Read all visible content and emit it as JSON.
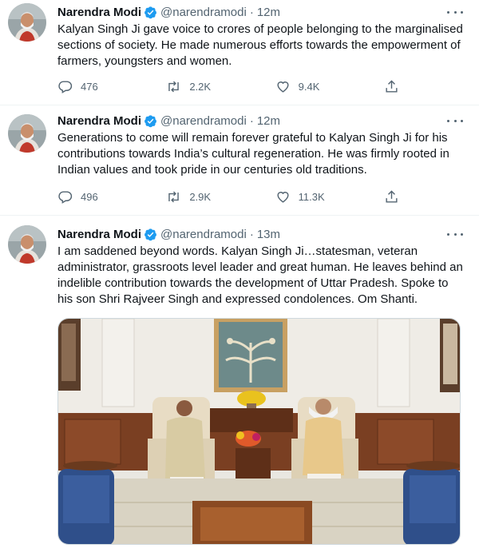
{
  "tweets": [
    {
      "name": "Narendra Modi",
      "handle": "@narendramodi",
      "dot": "·",
      "time": "12m",
      "text": "Kalyan Singh Ji gave voice to crores of people belonging to the marginalised sections of society. He made numerous efforts towards the empowerment of farmers, youngsters and women.",
      "replies": "476",
      "retweets": "2.2K",
      "likes": "9.4K"
    },
    {
      "name": "Narendra Modi",
      "handle": "@narendramodi",
      "dot": "·",
      "time": "12m",
      "text": "Generations to come will remain forever grateful to Kalyan Singh Ji for his contributions towards India’s cultural regeneration. He was firmly rooted in Indian values and took pride in our centuries old traditions.",
      "replies": "496",
      "retweets": "2.9K",
      "likes": "11.3K"
    },
    {
      "name": "Narendra Modi",
      "handle": "@narendramodi",
      "dot": "·",
      "time": "13m",
      "text": "I am saddened beyond words. Kalyan Singh Ji…statesman, veteran administrator, grassroots level leader and great human. He leaves behind an indelible contribution towards the development of Uttar Pradesh. Spoke to his son Shri Rajveer Singh and expressed condolences. Om Shanti."
    }
  ],
  "icons": {
    "verified": "verified-badge-icon",
    "more": "more-options-icon",
    "reply": "reply-icon",
    "retweet": "retweet-icon",
    "like": "like-icon",
    "share": "share-icon"
  },
  "colors": {
    "verified": "#1d9bf0",
    "muted": "#536471",
    "text": "#0f1419",
    "divider": "#eff3f4"
  }
}
